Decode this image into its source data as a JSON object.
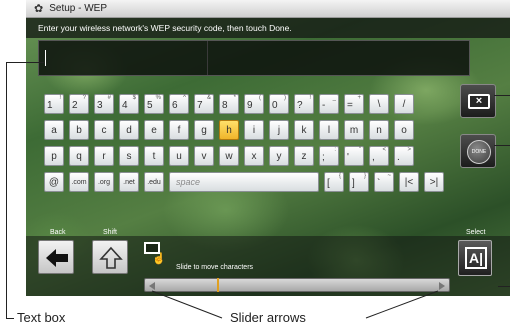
{
  "window": {
    "title": "Setup - WEP"
  },
  "instruction": "Enter your wireless network's WEP security code, then touch Done.",
  "text_field": {
    "value": ""
  },
  "keyboard": {
    "row1": [
      {
        "main": "1",
        "alt": "!"
      },
      {
        "main": "2",
        "alt": "?"
      },
      {
        "main": "3",
        "alt": "#"
      },
      {
        "main": "4",
        "alt": "$"
      },
      {
        "main": "5",
        "alt": "%"
      },
      {
        "main": "6",
        "alt": "^"
      },
      {
        "main": "7",
        "alt": "&"
      },
      {
        "main": "8",
        "alt": "*"
      },
      {
        "main": "9",
        "alt": "("
      },
      {
        "main": "0",
        "alt": ")"
      },
      {
        "main": "?",
        "alt": "!"
      },
      {
        "main": "-",
        "alt": "_"
      },
      {
        "main": "=",
        "alt": "+"
      },
      {
        "main": "\\",
        "alt": ""
      },
      {
        "main": "/",
        "alt": ""
      }
    ],
    "row2": [
      "a",
      "b",
      "c",
      "d",
      "e",
      "f",
      "g",
      "h",
      "i",
      "j",
      "k",
      "l",
      "m",
      "n",
      "o"
    ],
    "row3": [
      {
        "main": "p",
        "alt": ""
      },
      {
        "main": "q",
        "alt": ""
      },
      {
        "main": "r",
        "alt": ""
      },
      {
        "main": "s",
        "alt": ""
      },
      {
        "main": "t",
        "alt": ""
      },
      {
        "main": "u",
        "alt": ""
      },
      {
        "main": "v",
        "alt": ""
      },
      {
        "main": "w",
        "alt": ""
      },
      {
        "main": "x",
        "alt": ""
      },
      {
        "main": "y",
        "alt": ""
      },
      {
        "main": "z",
        "alt": ""
      },
      {
        "main": ";",
        "alt": ":"
      },
      {
        "main": "'",
        "alt": "\""
      },
      {
        "main": ",",
        "alt": "<"
      },
      {
        "main": ".",
        "alt": ">"
      }
    ],
    "row4": [
      "@",
      ".com",
      ".org",
      ".net",
      ".edu"
    ],
    "space_label": "space",
    "row4_right": [
      {
        "main": "[",
        "alt": "{"
      },
      {
        "main": "]",
        "alt": "}"
      },
      {
        "main": "`",
        "alt": "~"
      },
      {
        "main": "|<",
        "alt": ""
      },
      {
        "main": ">|",
        "alt": ""
      }
    ],
    "highlighted_key": "h"
  },
  "buttons": {
    "done_label": "DONE",
    "back_label": "Back",
    "shift_label": "Shift",
    "select_label": "Select"
  },
  "slider": {
    "hint": "Slide to move characters",
    "position": 0.24
  },
  "callouts": {
    "text_box": "Text box",
    "slider_arrows": "Slider arrows"
  },
  "colors": {
    "highlight": "#f0b52a",
    "screen_bg": "#3d6b35"
  }
}
